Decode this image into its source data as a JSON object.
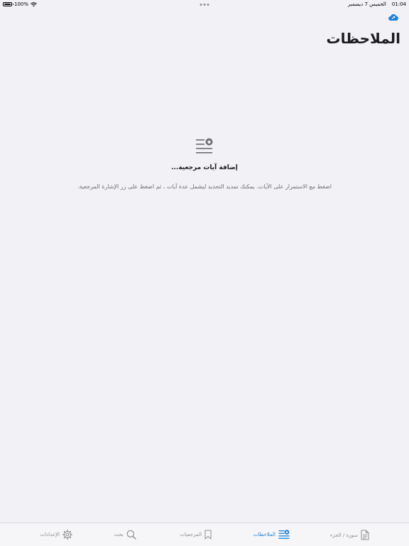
{
  "status_bar": {
    "time": "01:04",
    "date": "الخميس 7 ديسمبر",
    "battery": "100%",
    "battery_level": 1.0
  },
  "header": {
    "title": "الملاحظات",
    "cloud_icon": "cloud-sync-icon"
  },
  "empty_state": {
    "icon": "notes-star-icon",
    "title": "إضافة آيات مرجعية...",
    "description": "اضغط مع الاستمرار على الآيات. يمكنك تمديد التحديد ليشمل عدة آيات ، ثم اضغط على زر الإشارة المرجعية."
  },
  "tab_bar": {
    "tabs": [
      {
        "label": "سورة / الجزء",
        "icon": "document-icon",
        "active": false
      },
      {
        "label": "الملاحظات",
        "icon": "notes-icon",
        "active": true
      },
      {
        "label": "المرجعيات",
        "icon": "bookmark-icon",
        "active": false
      },
      {
        "label": "بحث",
        "icon": "search-icon",
        "active": false
      },
      {
        "label": "الإعدادات",
        "icon": "gear-icon",
        "active": false
      }
    ]
  },
  "colors": {
    "accent": "#1a80d9",
    "background": "#f2f1f6",
    "inactive": "#8e8e93"
  }
}
